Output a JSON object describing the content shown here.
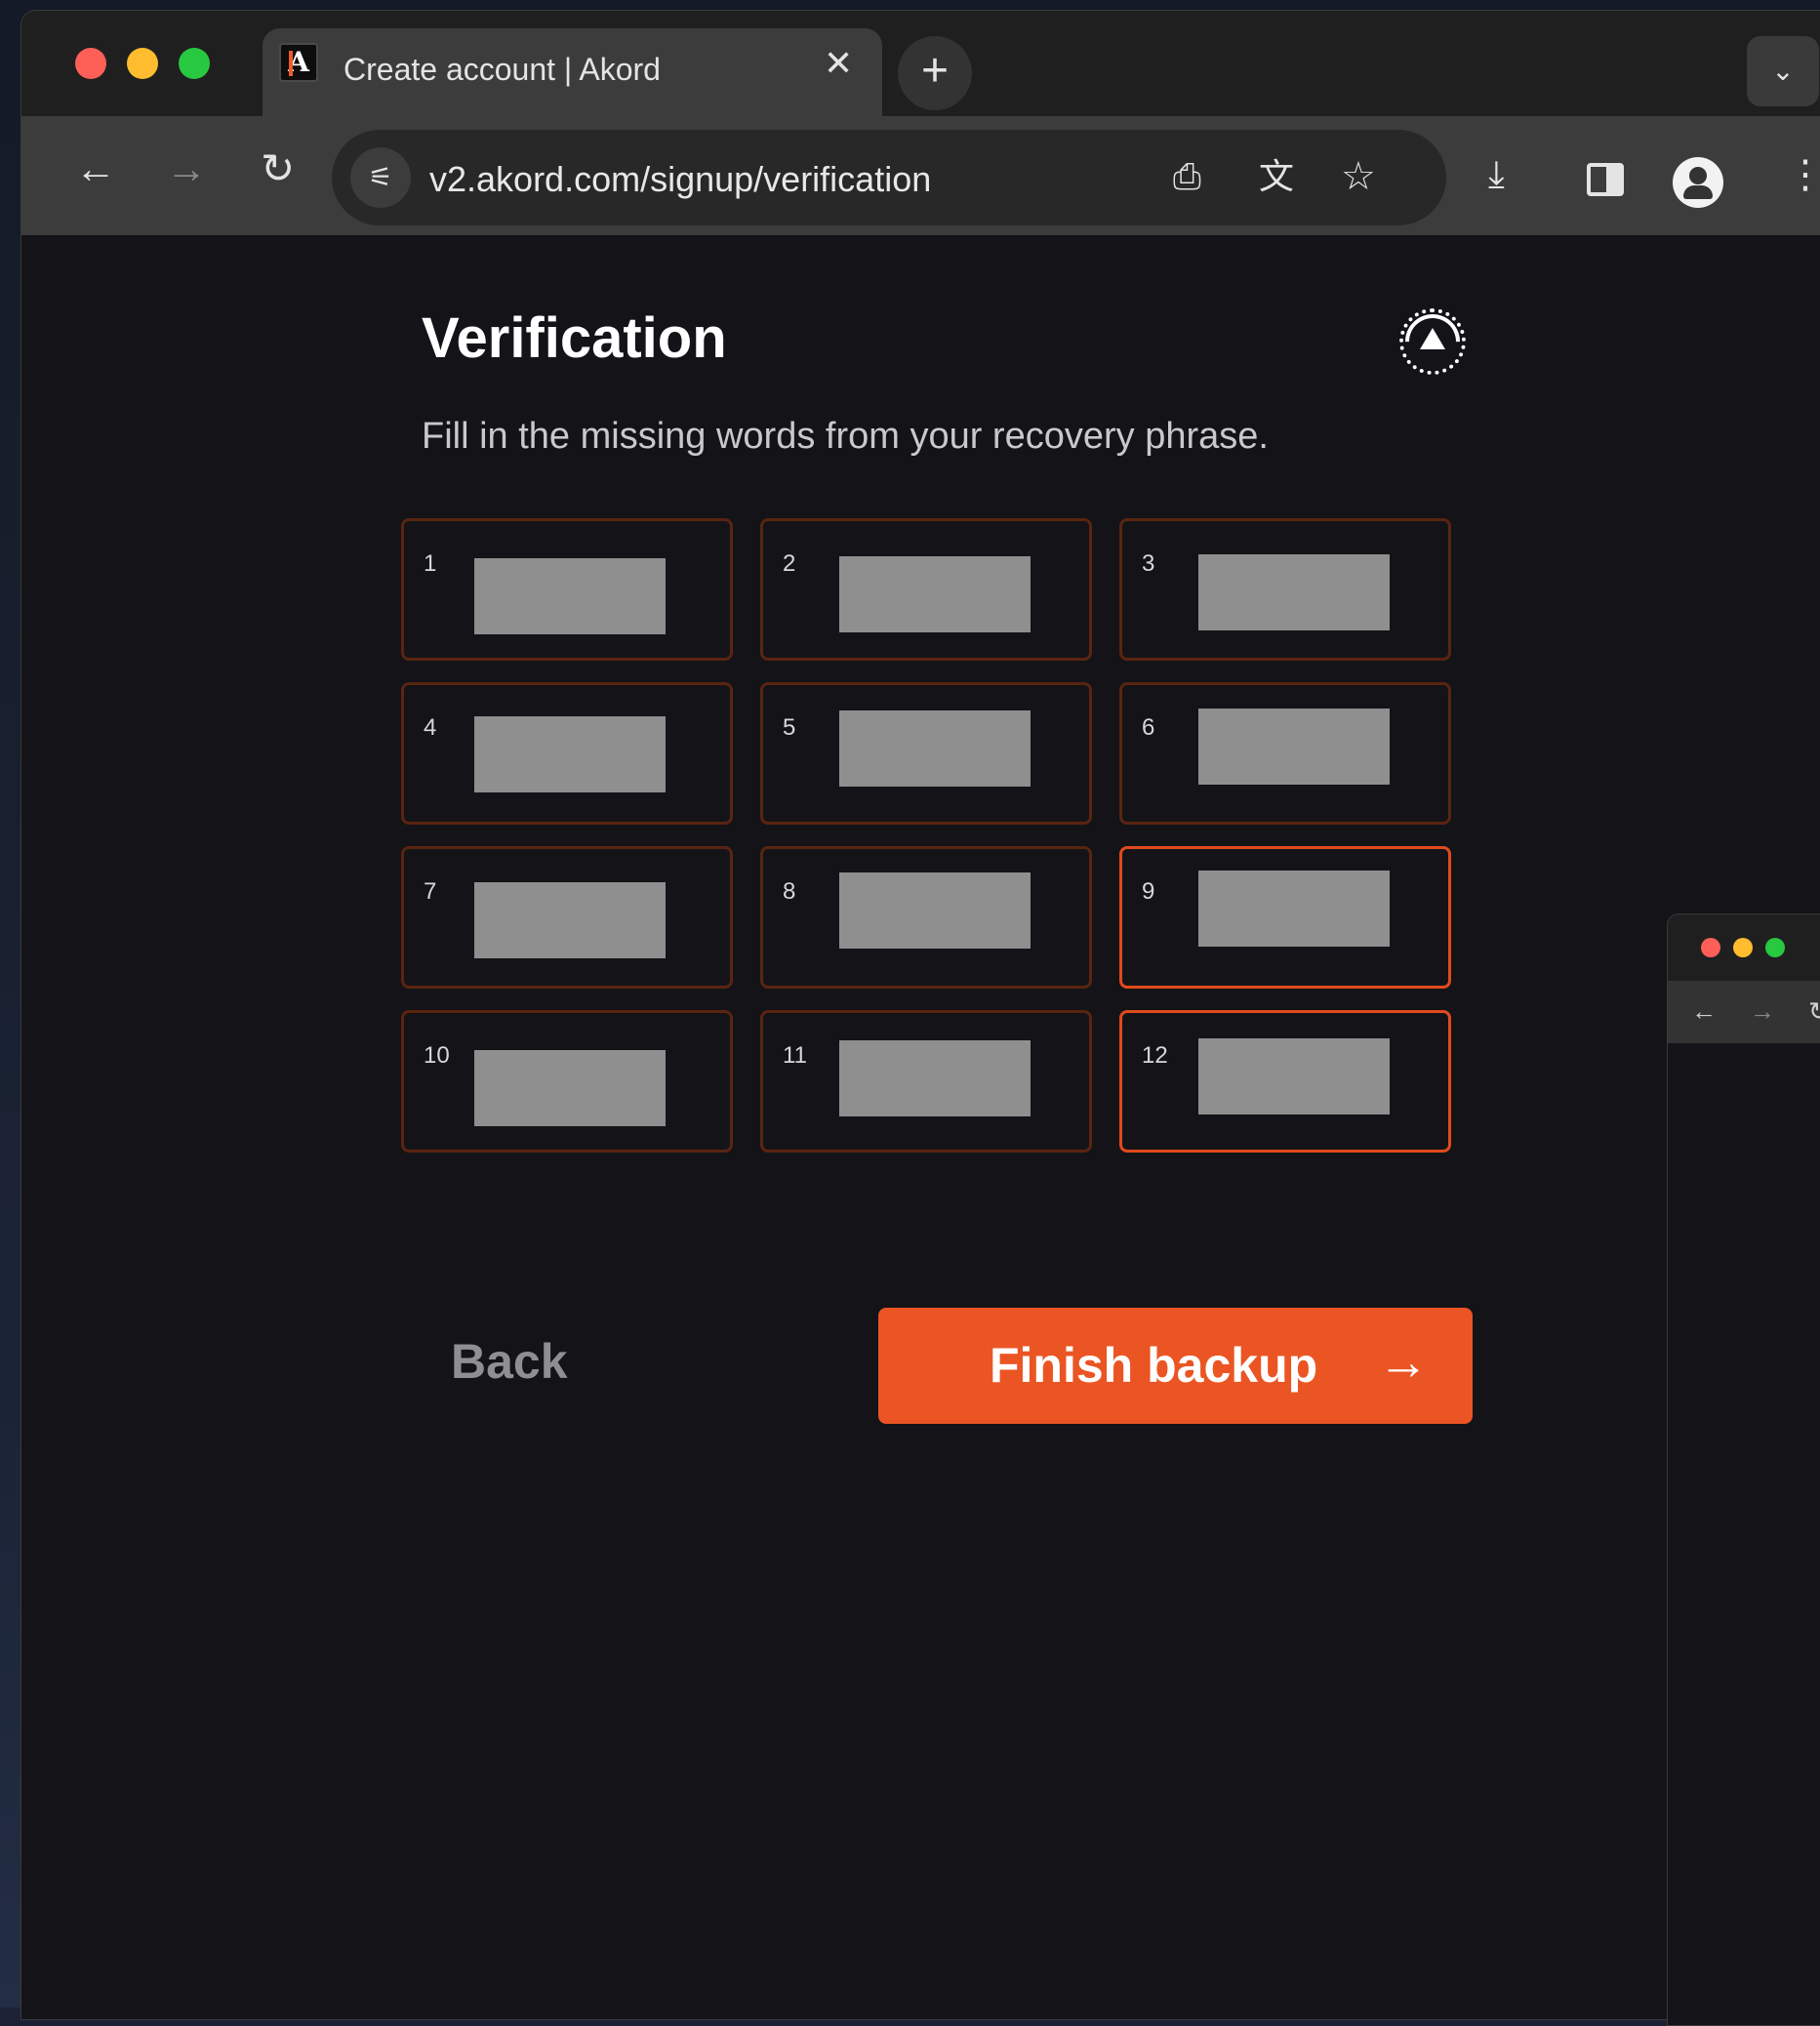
{
  "browser": {
    "tab_title": "Create account | Akord",
    "tab_close": "✕",
    "new_tab": "+",
    "tab_search": "⌄",
    "url": "v2.akord.com/signup/verification",
    "icons": {
      "back": "arrow-left-icon",
      "forward": "arrow-right-icon",
      "reload": "reload-icon",
      "site_info": "tune-icon",
      "install": "install-app-icon",
      "translate": "translate-icon",
      "bookmark": "star-icon",
      "download": "download-icon",
      "side_panel": "side-panel-icon",
      "profile": "profile-icon",
      "menu": "kebab-menu-icon"
    }
  },
  "page": {
    "title": "Verification",
    "subtitle": "Fill in the missing words from your recovery phrase.",
    "words": [
      {
        "label": "1"
      },
      {
        "label": "2"
      },
      {
        "label": "3"
      },
      {
        "label": "4"
      },
      {
        "label": "5"
      },
      {
        "label": "6"
      },
      {
        "label": "7"
      },
      {
        "label": "8"
      },
      {
        "label": "9"
      },
      {
        "label": "10"
      },
      {
        "label": "11"
      },
      {
        "label": "12"
      }
    ],
    "back_label": "Back",
    "finish_label": "Finish backup",
    "finish_arrow": "→"
  },
  "colors": {
    "accent": "#eb5524",
    "box_border": "#5a2410",
    "box_border_active": "#e14a1c",
    "background": "#131318"
  }
}
